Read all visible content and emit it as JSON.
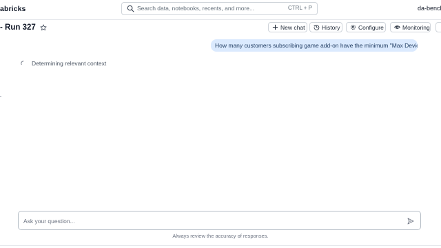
{
  "app": {
    "brand": "abricks",
    "workspace": "da-bench"
  },
  "search": {
    "placeholder": "Search data, notebooks, recents, and more...",
    "shortcut": "CTRL + P"
  },
  "header": {
    "title": "- Run 327",
    "buttons": {
      "new_chat": "New chat",
      "history": "History",
      "configure": "Configure",
      "monitoring": "Monitoring"
    }
  },
  "chat": {
    "user_message": "How many customers subscribing game add-on have the minimum \"Max Devices\"?",
    "status": "Determining relevant context"
  },
  "composer": {
    "placeholder": "Ask your question..."
  },
  "footer": {
    "disclaimer": "Always review the accuracy of responses."
  },
  "colors": {
    "user_bubble": "#dbeafe",
    "border": "#cfd4da",
    "text_muted": "#6b7280"
  },
  "icons": [
    "search-icon",
    "star-icon",
    "plus-icon",
    "history-icon",
    "gear-icon",
    "eye-icon",
    "more-icon",
    "spinner-icon",
    "send-icon"
  ]
}
